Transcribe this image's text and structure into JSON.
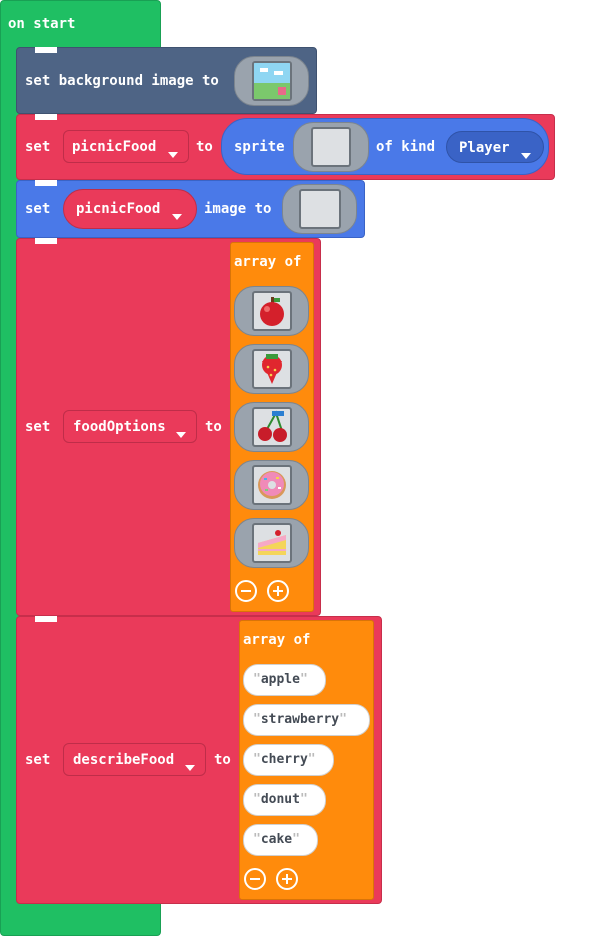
{
  "hat": {
    "label": "on start"
  },
  "stmt1": {
    "label": "set background image to",
    "icon": "landscape-image-icon"
  },
  "stmt2": {
    "set": "set",
    "variable": "picnicFood",
    "to": "to",
    "sprite": "sprite",
    "of_kind": "of kind",
    "kind": "Player"
  },
  "stmt3": {
    "set": "set",
    "variable": "picnicFood",
    "image_to": "image to"
  },
  "stmt4": {
    "set": "set",
    "variable": "foodOptions",
    "to": "to",
    "array_of": "array of",
    "items": [
      "apple-image-icon",
      "strawberry-image-icon",
      "cherry-image-icon",
      "donut-image-icon",
      "cake-image-icon"
    ]
  },
  "stmt5": {
    "set": "set",
    "variable": "describeFood",
    "to": "to",
    "array_of": "array of",
    "items": [
      "apple",
      "strawberry",
      "cherry",
      "donut",
      "cake"
    ]
  },
  "colors": {
    "event": "#1fbf63",
    "scene": "#4e6485",
    "variables": "#ea3a5a",
    "sprites": "#4a79e8",
    "arrays": "#ff8b0c"
  }
}
